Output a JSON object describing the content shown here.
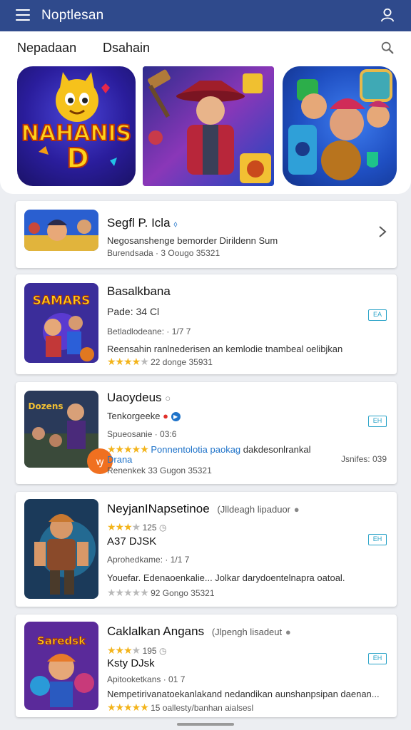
{
  "header": {
    "title": "Noptlesan",
    "menu_icon": "menu-icon",
    "profile_icon": "user-icon",
    "bg_color": "#2f4a8c"
  },
  "tabs": [
    {
      "label": "Nepadaan"
    },
    {
      "label": "Dsahain"
    }
  ],
  "featured": [
    {
      "name": "NAHANIS D",
      "logo_text": "NAHANIS",
      "logo_letter": "D"
    },
    {
      "name": "hero-art"
    },
    {
      "name": "clash-art"
    }
  ],
  "list": [
    {
      "title": "Segfl P. Icla",
      "title_badge": "⬨",
      "line1": "Negosanshenge bemorder Dirildenn Sum",
      "line2": "Burendsada · 3 Oougo 35321",
      "action": "chevron"
    },
    {
      "title": "Basalkbana",
      "thumb_text": "SAMARS",
      "line1": "Pade: 34  Cl",
      "line2": "Betladlodeane: · 1/7 7",
      "line3": "Reensahin ranlnederisen an kemlodie tnambeal oelibjkan",
      "rating_text": "22 donge 35931",
      "stars": 4,
      "side_label": "EA"
    },
    {
      "title": "Uaoydeus",
      "thumb_text": "Dozens",
      "line1": "Tenkorgeeke",
      "line2": "Spueosanie · 03:6",
      "line3_blue": "Ponnentolotia  paokag",
      "line3": "dakdesonlrankal",
      "line4_blue": "Drana",
      "line4_right": "Jsnifes: 039",
      "line5": "Renenkek 33 Gugon 35321",
      "stars": 5,
      "side_label": "EH"
    },
    {
      "title": "NeyjanINapsetinoe",
      "title_extra": "(Jlldeagh lipaduor",
      "rating_num": "125",
      "subtitle": "A37 DJSK",
      "line2": "Aprohedkame: · 1/1 7",
      "line3": "Youefar. Edenaoenkalie... Jolkar darydoentelnapra oatoal.",
      "rating_text": "92 Gongo 35321",
      "stars": 3,
      "side_label": "EH"
    },
    {
      "title": "Caklalkan Angans",
      "title_extra": "(Jlpengh lisadeut",
      "rating_num": "195",
      "thumb_text": "Saredsk",
      "subtitle": "Ksty DJsk",
      "line2": "Apitooketkans · 01 7",
      "line3": "Nempetirivanatoekanlakand nedandikan aunshanpsipan daenan...",
      "rating_text": "15 oallesty/banhan aialsesl",
      "stars": 4,
      "side_label": "EH"
    }
  ],
  "accent_color": "#2aa3c8",
  "star_color": "#f3b41b"
}
